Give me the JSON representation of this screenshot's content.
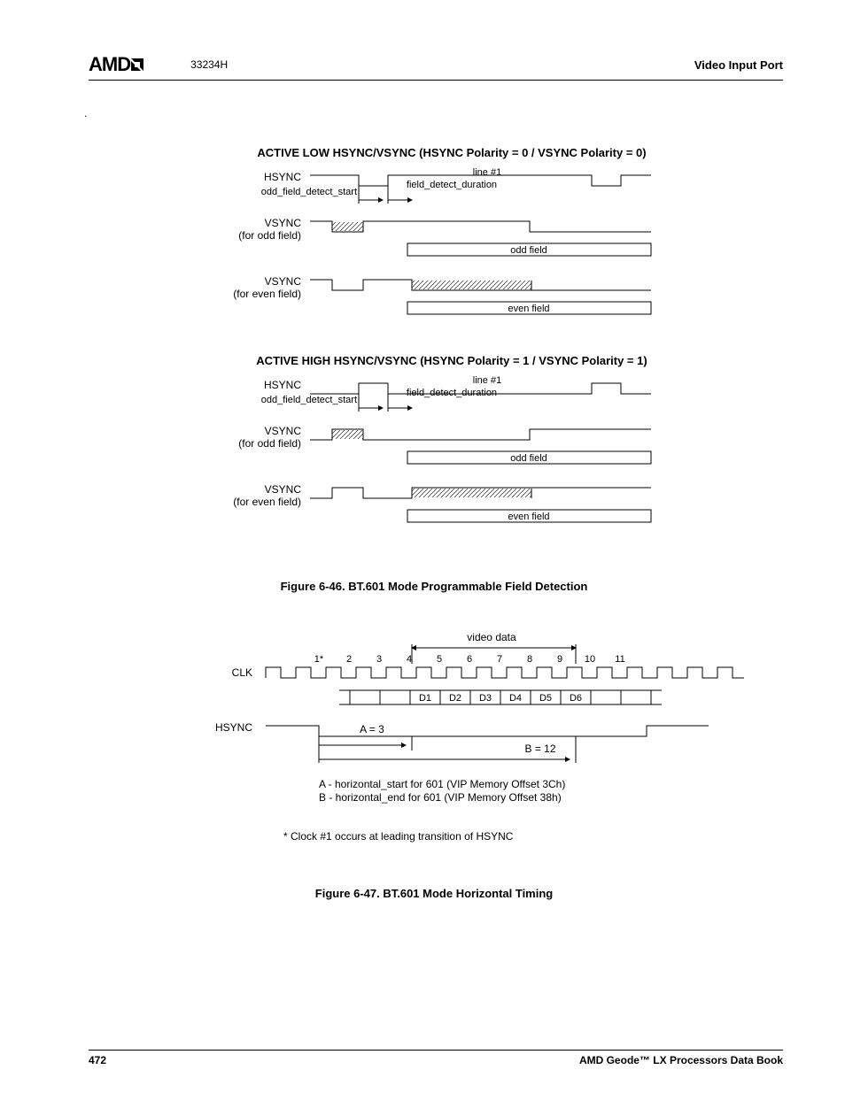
{
  "header": {
    "logo": "AMD",
    "docnum": "33234H",
    "section": "Video Input Port"
  },
  "dot": ".",
  "fig1": {
    "title_low": "ACTIVE LOW HSYNC/VSYNC (HSYNC Polarity = 0 / VSYNC Polarity = 0)",
    "title_high": "ACTIVE HIGH HSYNC/VSYNC (HSYNC Polarity = 1 / VSYNC Polarity = 1)",
    "labels": {
      "hsync": "HSYNC",
      "ofds": "odd_field_detect_start",
      "vsync_odd_1": "VSYNC",
      "vsync_odd_2": "(for odd field)",
      "vsync_even_1": "VSYNC",
      "vsync_even_2": "(for even field)",
      "line1": "line #1",
      "fdd": "field_detect_duration",
      "odd_field": "odd field",
      "even_field": "even field"
    },
    "caption": "Figure 6-46.  BT.601 Mode Programmable Field Detection"
  },
  "fig2": {
    "labels": {
      "clk": "CLK",
      "hsync": "HSYNC",
      "video_data": "video data",
      "A": "A = 3",
      "B": "B = 12",
      "clk_nums": [
        "1*",
        "2",
        "3",
        "4",
        "5",
        "6",
        "7",
        "8",
        "9",
        "10",
        "11"
      ],
      "d_cells": [
        "",
        "",
        "D1",
        "D2",
        "D3",
        "D4",
        "D5",
        "D6",
        "",
        ""
      ],
      "legend_a": "A - horizontal_start for 601 (VIP Memory Offset 3Ch)",
      "legend_b": "B - horizontal_end for 601 (VIP Memory Offset 38h)",
      "footnote": "* Clock #1 occurs at leading transition of HSYNC"
    },
    "caption": "Figure 6-47.  BT.601 Mode Horizontal Timing"
  },
  "footer": {
    "page": "472",
    "book": "AMD Geode™ LX Processors Data Book"
  }
}
